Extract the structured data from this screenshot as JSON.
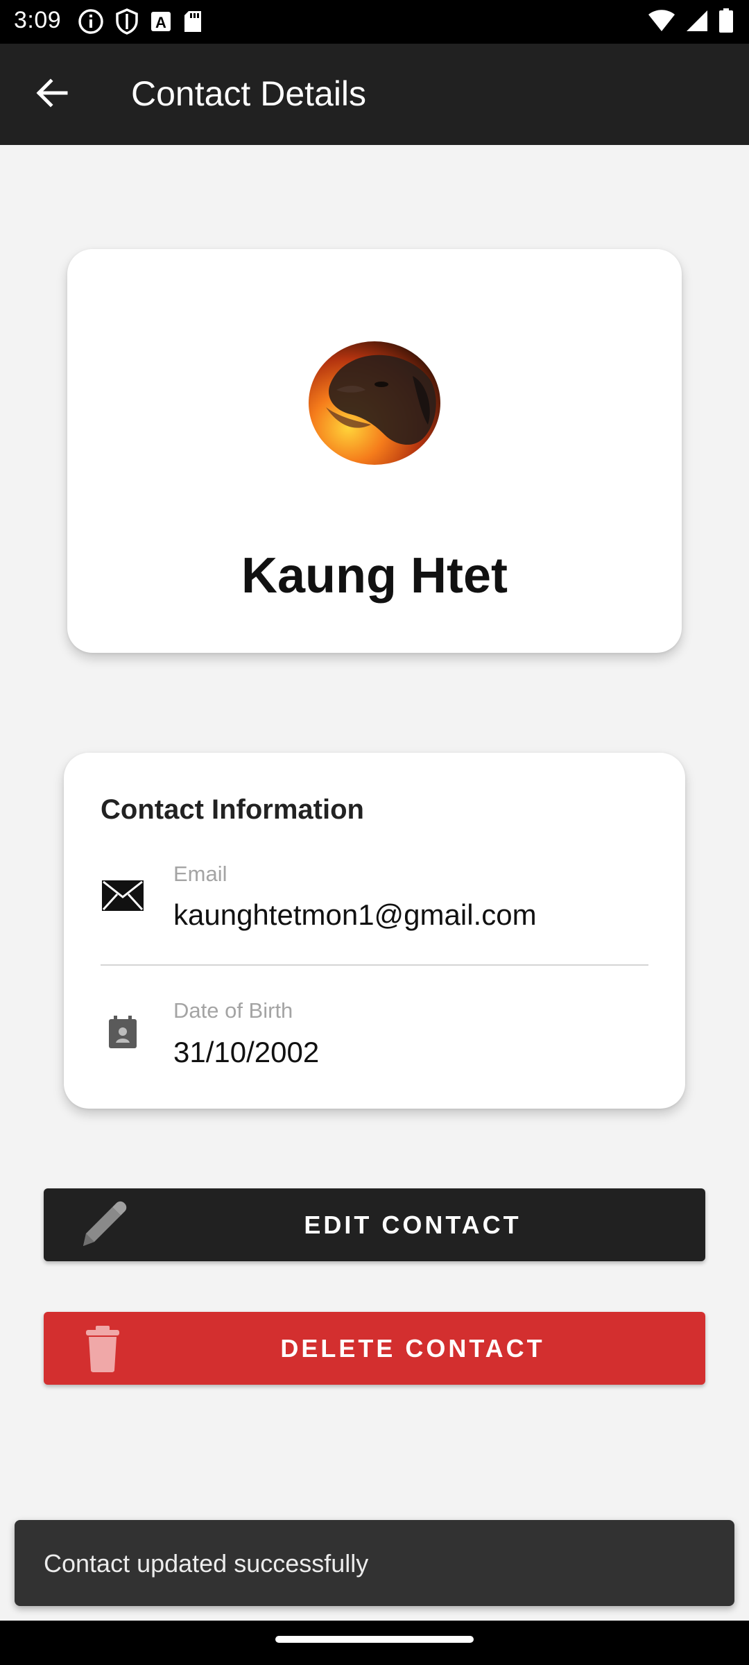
{
  "status_bar": {
    "time": "3:09",
    "icons_left": [
      "info-icon",
      "shield-icon",
      "text-a-icon",
      "sd-card-icon"
    ],
    "icons_right": [
      "wifi-icon",
      "signal-icon",
      "battery-icon"
    ]
  },
  "app_bar": {
    "back_icon": "arrow-back-icon",
    "title": "Contact Details"
  },
  "profile": {
    "name": "Kaung Htet",
    "avatar": "dog-photo"
  },
  "contact_info": {
    "heading": "Contact Information",
    "email_label": "Email",
    "email_value": "kaunghtetmon1@gmail.com",
    "email_icon": "envelope-icon",
    "dob_label": "Date of Birth",
    "dob_value": "31/10/2002",
    "dob_icon": "calendar-icon"
  },
  "actions": {
    "edit_label": "EDIT CONTACT",
    "edit_icon": "pencil-icon",
    "delete_label": "DELETE CONTACT",
    "delete_icon": "trash-icon"
  },
  "snackbar": {
    "message": "Contact updated successfully"
  },
  "colors": {
    "app_bar": "#212121",
    "background": "#f3f3f3",
    "edit_button": "#212121",
    "delete_button": "#d32f2f",
    "snackbar": "#323232"
  }
}
